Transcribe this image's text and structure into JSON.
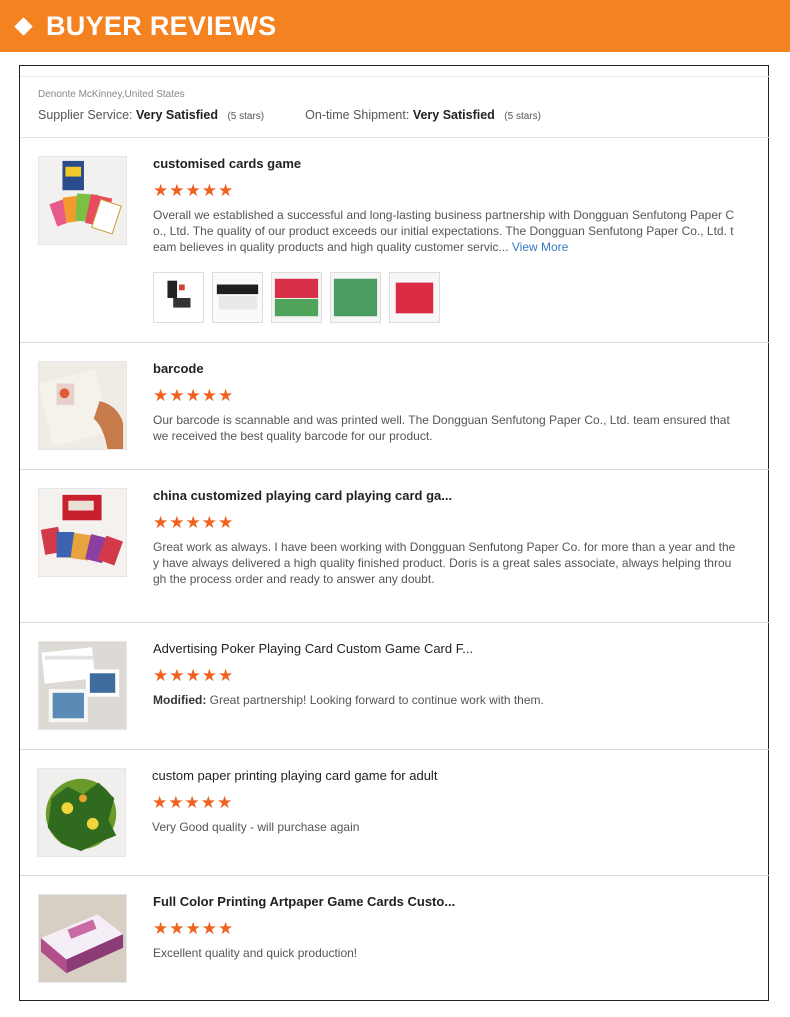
{
  "banner": {
    "title": "BUYER REVIEWS"
  },
  "reviewer": {
    "name": "Denonte McKinney,United States",
    "supplier_label": "Supplier Service:",
    "supplier_value": "Very Satisfied",
    "supplier_stars": "(5 stars)",
    "shipment_label": "On-time Shipment:",
    "shipment_value": "Very Satisfied",
    "shipment_stars": "(5 stars)"
  },
  "reviews": [
    {
      "title": "customised cards game",
      "rating": 5,
      "stars": "★★★★★",
      "text": "Overall we established a successful and long-lasting business partnership with Dongguan Senfutong Paper Co., Ltd. The quality of our product exceeds our initial expectations. The Dongguan Senfutong Paper Co., Ltd. team believes in quality products and high quality customer servic...",
      "more": "View More"
    },
    {
      "title": "barcode",
      "rating": 5,
      "stars": "★★★★★",
      "text": "Our barcode is scannable and was printed well. The Dongguan Senfutong Paper Co., Ltd. team ensured that we received the best quality barcode for our product."
    },
    {
      "title": "china customized playing card playing card ga...",
      "rating": 5,
      "stars": "★★★★★",
      "text": "Great work as always. I have been working with Dongguan Senfutong Paper Co. for more than a year and they have always delivered a high quality finished product. Doris is a great sales associate, always helping through the process order and ready to answer any doubt."
    },
    {
      "title": "Advertising Poker Playing Card Custom Game Card F...",
      "rating": 5,
      "stars": "★★★★★",
      "modified": "Modified:",
      "text": "Great partnership! Looking forward to continue work with them."
    },
    {
      "title": "custom paper printing playing card game for adult",
      "rating": 5,
      "stars": "★★★★★",
      "text": "Very Good quality - will purchase again"
    },
    {
      "title": "Full Color Printing Artpaper Game Cards Custo...",
      "rating": 5,
      "stars": "★★★★★",
      "text": "Excellent quality and quick production!"
    }
  ],
  "colors": {
    "banner": "#f58220",
    "stars": "#f0621f",
    "link": "#3877c3"
  },
  "icons": {
    "banner_marker": "diamond-icon",
    "rating": "star-icon"
  }
}
